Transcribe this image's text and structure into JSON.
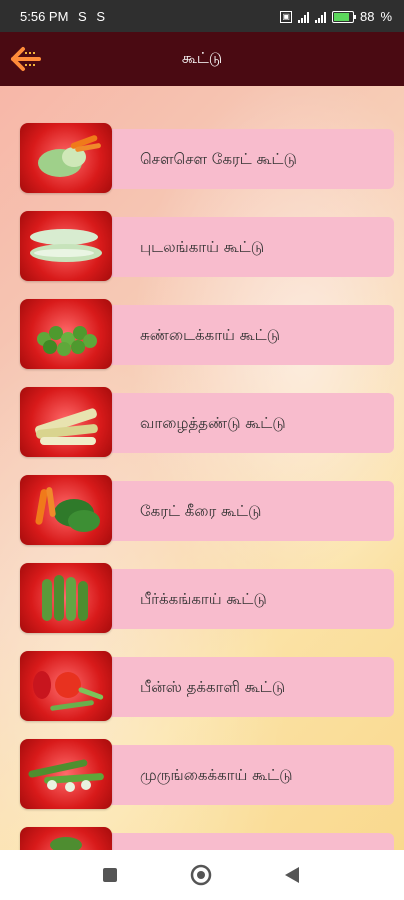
{
  "status": {
    "time": "5:56 PM",
    "indicators": [
      "S",
      "S"
    ],
    "battery": "88"
  },
  "header": {
    "title": "கூட்டு"
  },
  "recipes": [
    {
      "label": "சௌசௌ கேரட் கூட்டு",
      "icon": "chayote-carrot-image"
    },
    {
      "label": "புடலங்காய் கூட்டு",
      "icon": "snake-gourd-image"
    },
    {
      "label": "சுண்டைக்காய் கூட்டு",
      "icon": "turkey-berry-image"
    },
    {
      "label": "வாழைத்தண்டு கூட்டு",
      "icon": "banana-stem-image"
    },
    {
      "label": "கேரட் கீரை கூட்டு",
      "icon": "carrot-greens-image"
    },
    {
      "label": "பீர்க்கங்காய் கூட்டு",
      "icon": "ridge-gourd-image"
    },
    {
      "label": "பீன்ஸ் தக்காளி கூட்டு",
      "icon": "beans-tomato-image"
    },
    {
      "label": "முருங்கைக்காய் கூட்டு",
      "icon": "drumstick-image"
    }
  ],
  "colors": {
    "app_bar": "#4a0a12",
    "label_bar": "#f8bccd",
    "thumb_red": "#d81a1a"
  }
}
